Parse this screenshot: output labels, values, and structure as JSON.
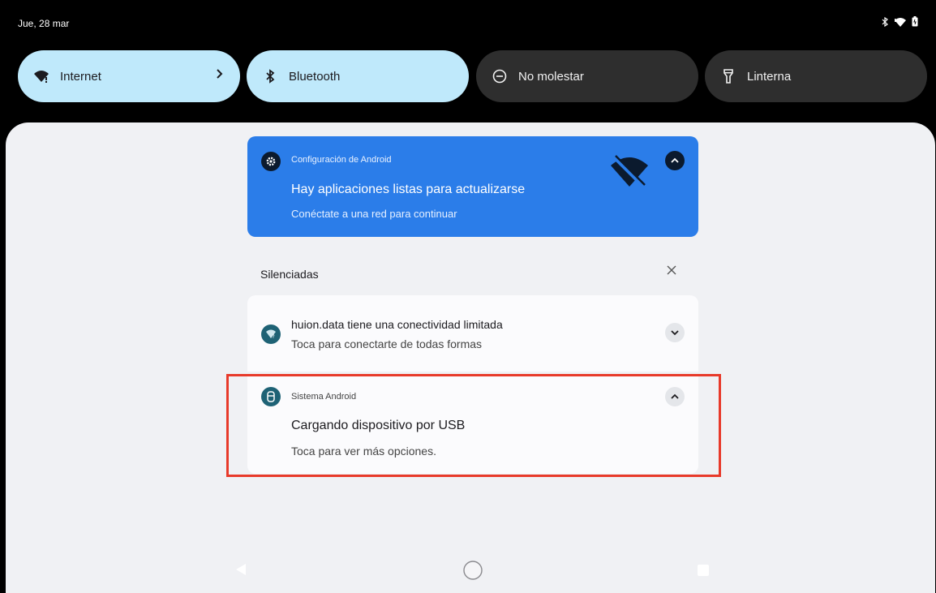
{
  "status_bar": {
    "date": "Jue, 28 mar",
    "icons": [
      "bluetooth-icon",
      "wifi-icon",
      "battery-icon"
    ]
  },
  "quick_tiles": [
    {
      "label": "Internet",
      "icon": "wifi-icon",
      "state": "on",
      "has_chevron": true
    },
    {
      "label": "Bluetooth",
      "icon": "bluetooth-icon",
      "state": "on"
    },
    {
      "label": "No molestar",
      "icon": "do-not-disturb-icon",
      "state": "off"
    },
    {
      "label": "Linterna",
      "icon": "flashlight-icon",
      "state": "off"
    }
  ],
  "notification_android_settings": {
    "app": "Configuración de Android",
    "title": "Hay aplicaciones listas para actualizarse",
    "text": "Conéctate a una red para continuar",
    "icon": "settings-gear-icon",
    "large_icon": "wifi-off-icon",
    "color": "#2b7de9"
  },
  "silenced_section": {
    "label": "Silenciadas"
  },
  "notification_wifi": {
    "title": "huion.data tiene una conectividad limitada",
    "text": "Toca para conectarte de todas formas",
    "icon": "wifi-question-icon"
  },
  "notification_usb": {
    "app": "Sistema Android",
    "title": "Cargando dispositivo por USB",
    "text": "Toca para ver más opciones.",
    "icon": "usb-icon"
  },
  "colors": {
    "tile_active": "#bfe9fb",
    "tile_inactive": "#2e2e2e",
    "shade_bg": "#f0f1f4",
    "highlight": "#e83a2a",
    "app_icon_teal": "#1e6275"
  },
  "navigation": [
    "back-icon",
    "home-icon",
    "recents-icon"
  ]
}
